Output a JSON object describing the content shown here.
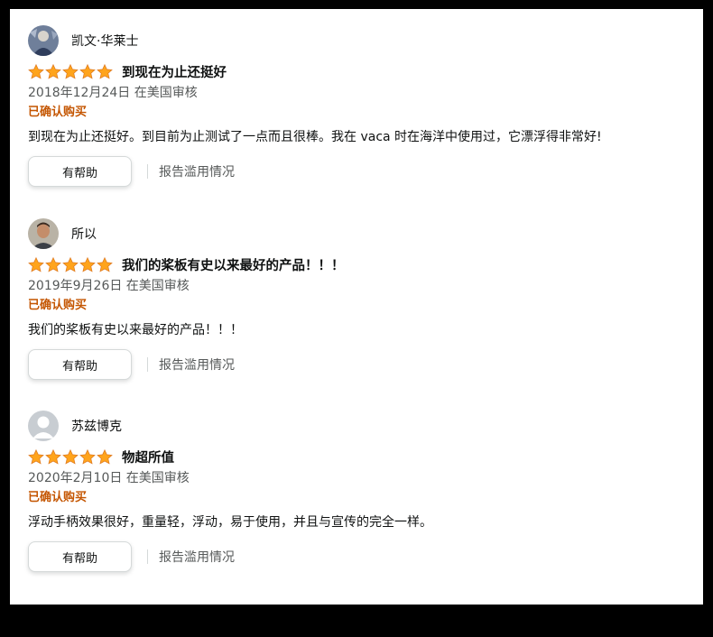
{
  "colors": {
    "star": "#ffa41c",
    "verified": "#c45500",
    "meta": "#565959"
  },
  "reviews": [
    {
      "name": "凯文·华莱士",
      "stars": 5,
      "title": "到现在为止还挺好",
      "date": "2018年12月24日 在美国审核",
      "verified": "已确认购买",
      "body": "到现在为止还挺好。到目前为止测试了一点而且很棒。我在 vaca 时在海洋中使用过，它漂浮得非常好!",
      "helpful": "有帮助",
      "report": "报告滥用情况"
    },
    {
      "name": "所以",
      "stars": 5,
      "title": "我们的桨板有史以来最好的产品！！！",
      "date": "2019年9月26日 在美国审核",
      "verified": "已确认购买",
      "body": "我们的桨板有史以来最好的产品！！！",
      "helpful": "有帮助",
      "report": "报告滥用情况"
    },
    {
      "name": "苏兹博克",
      "stars": 5,
      "title": "物超所值",
      "date": "2020年2月10日 在美国审核",
      "verified": "已确认购买",
      "body": "浮动手柄效果很好，重量轻，浮动，易于使用，并且与宣传的完全一样。",
      "helpful": "有帮助",
      "report": "报告滥用情况"
    }
  ]
}
